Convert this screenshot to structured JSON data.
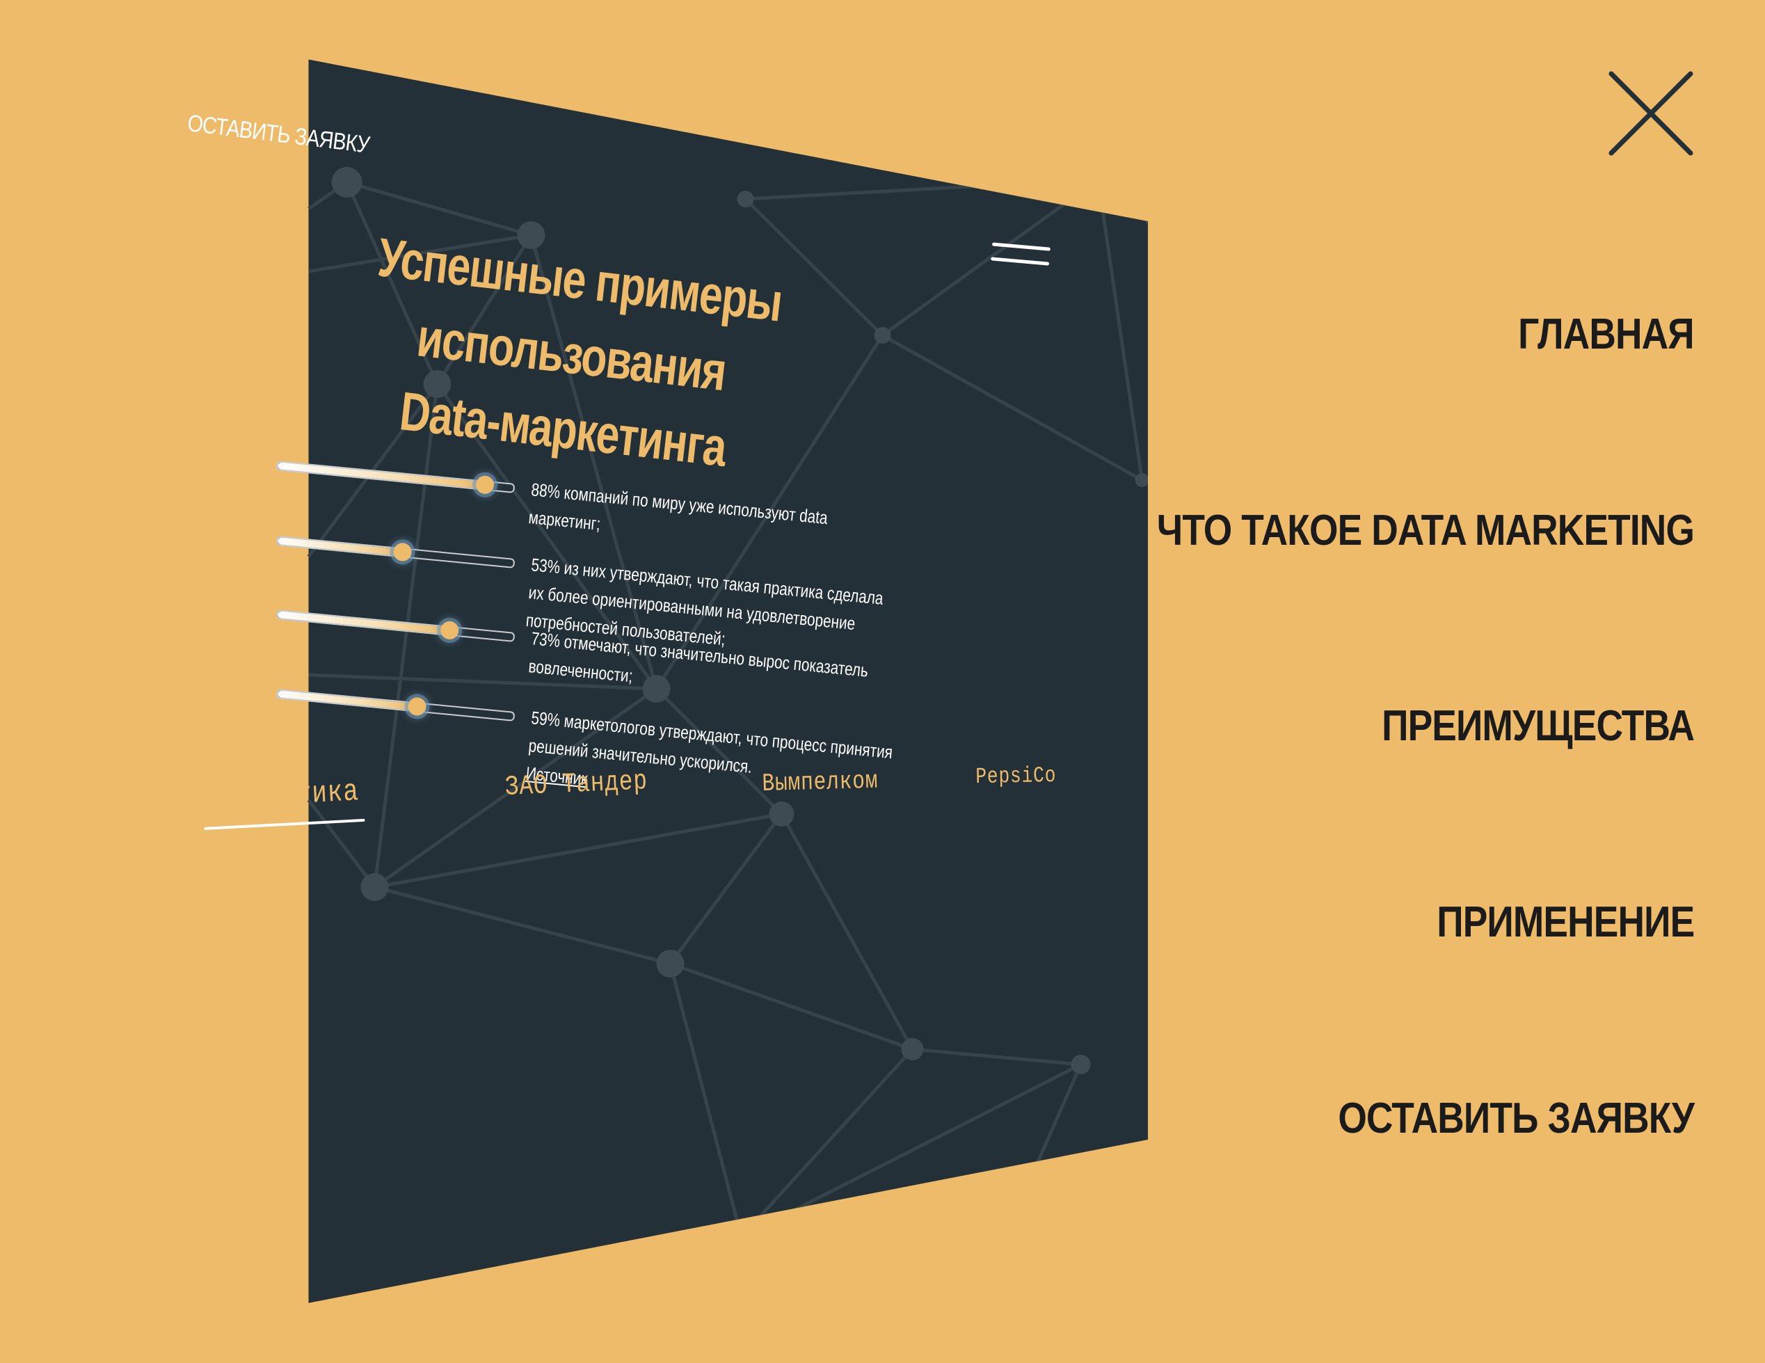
{
  "colors": {
    "background": "#eebb6a",
    "panel": "#233038",
    "accent": "#eebb6a",
    "menu_text": "#1b1b1b",
    "panel_text": "#ffffff"
  },
  "header": {
    "apply_label": "ОСТАВИТЬ ЗАЯВКУ",
    "menu_icon": "hamburger-icon"
  },
  "main": {
    "title_line1": "Успешные примеры использования",
    "title_line2": "Data-маркетинга",
    "stats": [
      {
        "percent": 88,
        "value_fraction": 0.88,
        "text": "88% компаний по миру уже используют data маркетинг;"
      },
      {
        "percent": 53,
        "value_fraction": 0.53,
        "text": "53% из них утверждают, что такая практика сделала их более ориентированными на удовлетворение потребностей пользователей;"
      },
      {
        "percent": 73,
        "value_fraction": 0.73,
        "text": "73% отмечают, что значительно вырос показатель вовлеченности;"
      },
      {
        "percent": 59,
        "value_fraction": 0.59,
        "text": "59% маркетологов утверждают, что процесс принятия решений значительно ускорился."
      }
    ],
    "source_label": "Источник",
    "tabs": [
      {
        "label": "Статистика",
        "active": true
      },
      {
        "label": "ЗАО Тандер",
        "active": false
      },
      {
        "label": "Вымпелком",
        "active": false
      },
      {
        "label": "PepsiCo",
        "active": false
      }
    ]
  },
  "menu": {
    "close_icon": "close-icon",
    "items": [
      {
        "label": "ГЛАВНАЯ"
      },
      {
        "label": "ЧТО ТАКОЕ DATA MARKETING"
      },
      {
        "label": "ПРЕИМУЩЕСТВА"
      },
      {
        "label": "ПРИМЕНЕНИЕ"
      },
      {
        "label": "ОСТАВИТЬ ЗАЯВКУ"
      }
    ]
  }
}
